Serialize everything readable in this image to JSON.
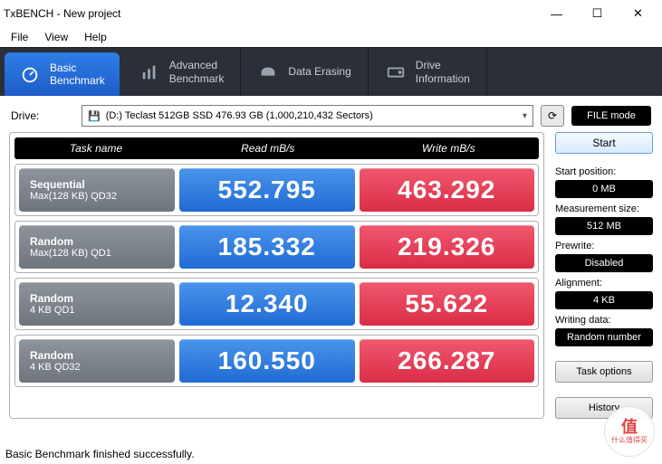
{
  "window": {
    "title": "TxBENCH - New project"
  },
  "menu": {
    "file": "File",
    "view": "View",
    "help": "Help"
  },
  "tabs": {
    "basic": "Basic\nBenchmark",
    "advanced": "Advanced\nBenchmark",
    "erase": "Data Erasing",
    "drive": "Drive\nInformation"
  },
  "drive": {
    "label": "Drive:",
    "value": "(D:) Teclast 512GB SSD  476.93 GB (1,000,210,432 Sectors)",
    "filemode": "FILE mode"
  },
  "headers": {
    "task": "Task name",
    "read": "Read mB/s",
    "write": "Write mB/s"
  },
  "rows": [
    {
      "name": "Sequential",
      "sub": "Max(128 KB) QD32",
      "read": "552.795",
      "write": "463.292"
    },
    {
      "name": "Random",
      "sub": "Max(128 KB) QD1",
      "read": "185.332",
      "write": "219.326"
    },
    {
      "name": "Random",
      "sub": "4 KB QD1",
      "read": "12.340",
      "write": "55.622"
    },
    {
      "name": "Random",
      "sub": "4 KB QD32",
      "read": "160.550",
      "write": "266.287"
    }
  ],
  "side": {
    "start": "Start",
    "startpos_label": "Start position:",
    "startpos": "0 MB",
    "meas_label": "Measurement size:",
    "meas": "512 MB",
    "prewrite_label": "Prewrite:",
    "prewrite": "Disabled",
    "align_label": "Alignment:",
    "align": "4 KB",
    "wdata_label": "Writing data:",
    "wdata": "Random number",
    "taskopt": "Task options",
    "history": "History"
  },
  "status": "Basic Benchmark finished successfully.",
  "watermark": {
    "big": "值",
    "small": "什么值得买"
  }
}
